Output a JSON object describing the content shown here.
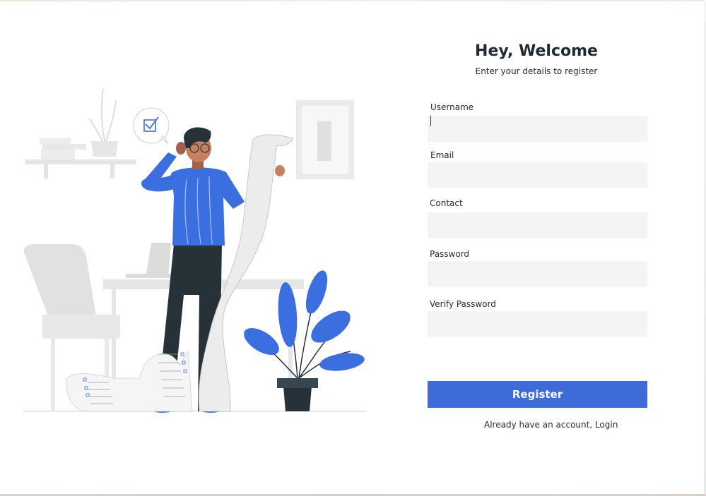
{
  "form": {
    "title": "Hey, Welcome",
    "subtitle": "Enter your details to register",
    "fields": [
      {
        "label": "Username",
        "value": "",
        "placeholder": ""
      },
      {
        "label": "Email",
        "value": "",
        "placeholder": ""
      },
      {
        "label": "Contact",
        "value": "",
        "placeholder": ""
      },
      {
        "label": "Password",
        "value": "",
        "placeholder": ""
      },
      {
        "label": "Verify Password",
        "value": "",
        "placeholder": ""
      }
    ],
    "register_label": "Register",
    "login_prompt": "Already have an account, Login"
  },
  "colors": {
    "accent": "#3e6bd8",
    "illustration_blue": "#3b6fe0",
    "input_bg": "#f4f4f4",
    "title_text": "#1f2a33"
  },
  "illustration": {
    "subject": "person-reading-long-list-icon"
  }
}
